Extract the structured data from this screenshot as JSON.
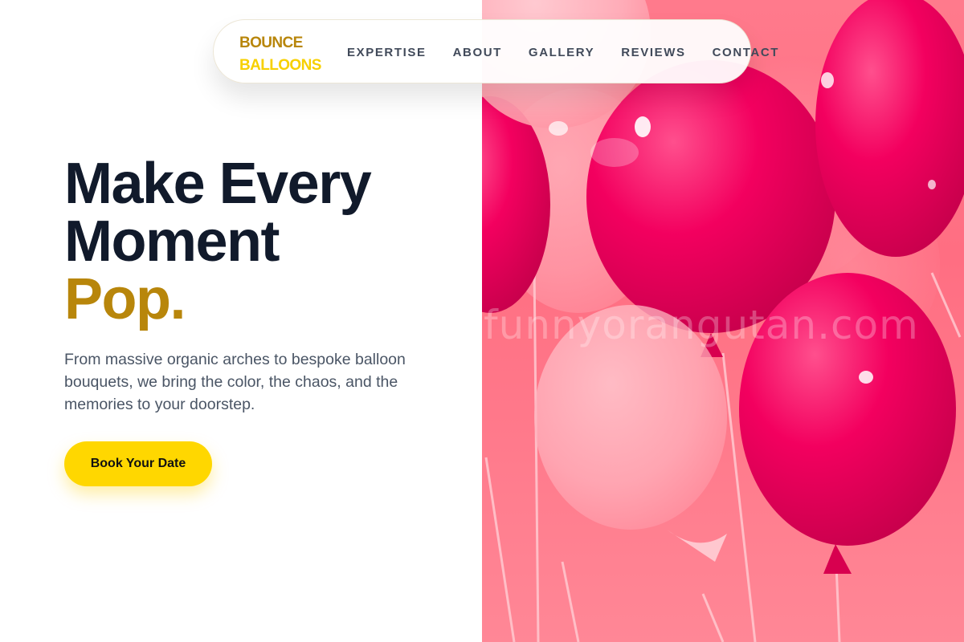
{
  "brand": {
    "line1": "BOUNCE",
    "line2": "BALLOONS"
  },
  "nav": {
    "items": [
      {
        "label": "EXPERTISE"
      },
      {
        "label": "ABOUT"
      },
      {
        "label": "GALLERY"
      },
      {
        "label": "REVIEWS"
      },
      {
        "label": "CONTACT"
      }
    ]
  },
  "hero": {
    "headline_line1": "Make Every",
    "headline_line2": "Moment",
    "headline_accent": "Pop.",
    "subtext": "From massive organic arches to bespoke balloon bouquets, we bring the color, the chaos, and the memories to your doorstep.",
    "cta_label": "Book Your Date"
  },
  "image": {
    "watermark": "funnyorangutan.com"
  },
  "colors": {
    "accent": "#b8860b",
    "brand_yellow": "#f7d000",
    "cta": "#ffd700",
    "headline": "#111a2b",
    "body_text": "#4a5565"
  }
}
